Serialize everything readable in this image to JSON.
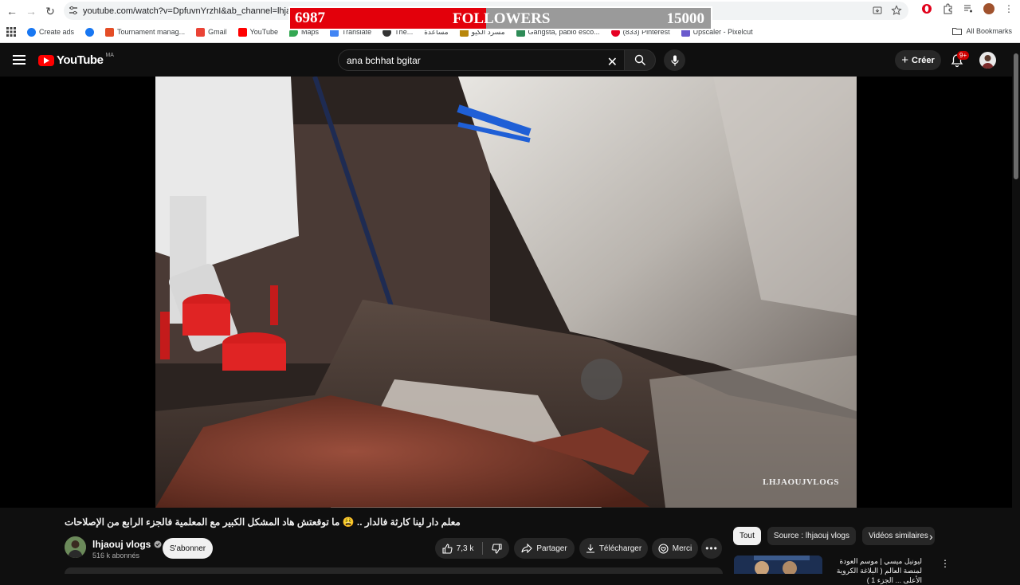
{
  "browser": {
    "url": "youtube.com/watch?v=DpfuvnYrzhI&ab_channel=lhjaoujvlogs",
    "bookmarks": [
      {
        "label": "Create ads",
        "color": "#1877f2"
      },
      {
        "label": "",
        "color": "#1877f2"
      },
      {
        "label": "Tournament manag...",
        "color": "#e44d26"
      },
      {
        "label": "Gmail",
        "color": "#ea4335"
      },
      {
        "label": "YouTube",
        "color": "#ff0000"
      },
      {
        "label": "Maps",
        "color": "#34a853"
      },
      {
        "label": "Translate",
        "color": "#4285f4"
      },
      {
        "label": "The...",
        "color": "#333333"
      },
      {
        "label": "مساعدة",
        "color": "#666666"
      },
      {
        "label": "مسرد الكيو",
        "color": "#b8860b"
      },
      {
        "label": "Gangsta, pablo esco...",
        "color": "#2e8b57"
      },
      {
        "label": "(833) Pinterest",
        "color": "#e60023"
      },
      {
        "label": "Upscaler - Pixelcut",
        "color": "#6a5acd"
      }
    ],
    "all_bookmarks": "All Bookmarks"
  },
  "followers": {
    "current": "6987",
    "label": "FOLLOWERS",
    "goal": "15000",
    "progress": 0.4658,
    "fill_color": "#e3000b"
  },
  "header": {
    "logo": "YouTube",
    "country": "MA",
    "search_value": "ana bchhat bgitar",
    "create_label": "Créer",
    "notif_badge": "9+"
  },
  "video": {
    "watermark": "LHJAOUJVLOGS",
    "title": "معلم دار لينا كارثة فالدار .. 😩 ما توقعتش هاد المشكل الكبير مع المعلمية فالجزء الرابع من الإصلاحات"
  },
  "channel": {
    "name": "lhjaouj vlogs",
    "subscribers": "516 k abonnés",
    "subscribe_label": "S'abonner"
  },
  "actions": {
    "likes": "7,3 k",
    "share": "Partager",
    "download": "Télécharger",
    "thanks": "Merci"
  },
  "sidebar": {
    "chips": [
      "Tout",
      "Source : lhjaouj vlogs",
      "Vidéos similaires"
    ],
    "first_rec_title": "ليونيل ميسي | موسم العودة لمنصة العالم ( البلاغة الكروية الأعلى ... الجزء 1 )"
  }
}
